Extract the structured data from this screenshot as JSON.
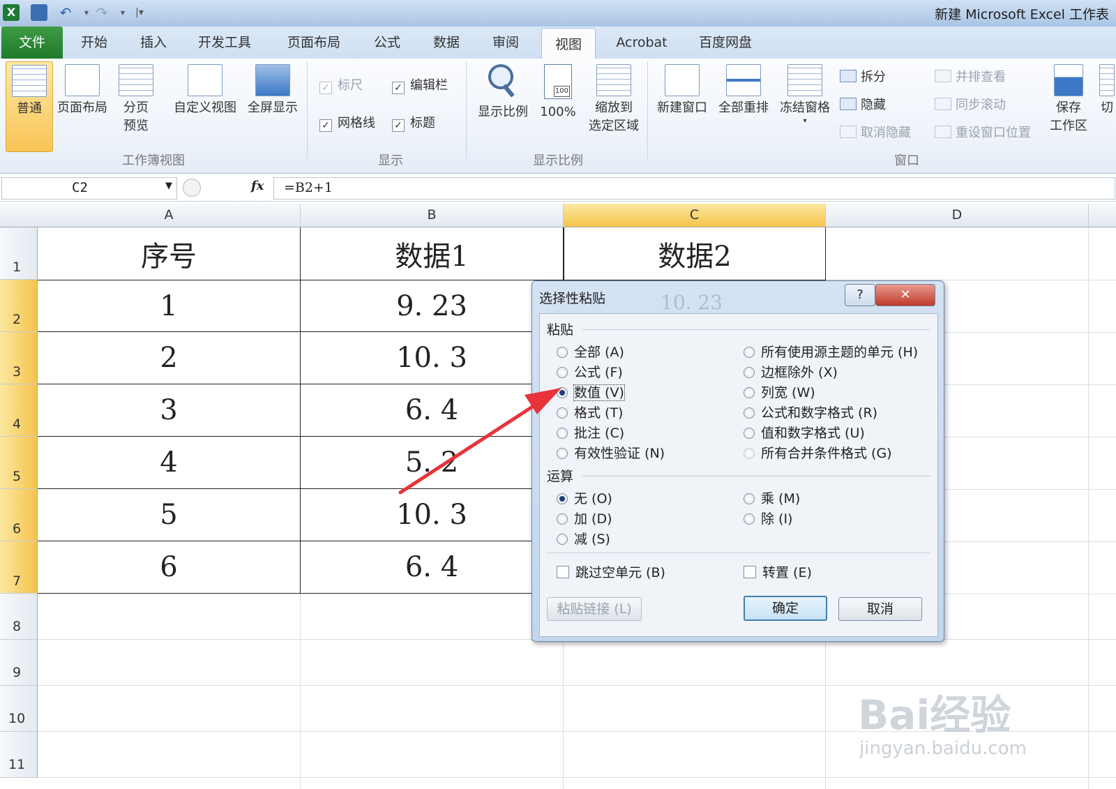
{
  "titlebar": {
    "title": "新建 Microsoft Excel 工作表"
  },
  "tabs": [
    "文件",
    "开始",
    "插入",
    "开发工具",
    "页面布局",
    "公式",
    "数据",
    "审阅",
    "视图",
    "Acrobat",
    "百度网盘"
  ],
  "ribbon": {
    "workbook_views": {
      "normal": "普通",
      "page_layout": "页面布局",
      "page_break_l1": "分页",
      "page_break_l2": "预览",
      "custom": "自定义视图",
      "fullscreen": "全屏显示",
      "group": "工作簿视图"
    },
    "show": {
      "ruler": "标尺",
      "formula_bar": "编辑栏",
      "gridlines": "网格线",
      "headings": "标题",
      "group": "显示"
    },
    "zoom": {
      "zoom": "显示比例",
      "zoom100": "100%",
      "zoom_sel_l1": "缩放到",
      "zoom_sel_l2": "选定区域",
      "group": "显示比例",
      "badge": "100"
    },
    "window": {
      "new_window": "新建窗口",
      "arrange_all": "全部重排",
      "freeze": "冻结窗格",
      "split": "拆分",
      "hide": "隐藏",
      "unhide": "取消隐藏",
      "side_by_side": "并排查看",
      "sync_scroll": "同步滚动",
      "reset_pos": "重设窗口位置",
      "save_l1": "保存",
      "save_l2": "工作区",
      "switch": "切",
      "group": "窗口"
    }
  },
  "formula_bar": {
    "name_box": "C2",
    "fx": "fx",
    "formula": "=B2+1"
  },
  "grid": {
    "columns": [
      "A",
      "B",
      "C",
      "D"
    ],
    "rows": [
      "1",
      "2",
      "3",
      "4",
      "5",
      "6",
      "7",
      "8",
      "9",
      "10",
      "11"
    ],
    "header_row": [
      "序号",
      "数据1",
      "数据2"
    ],
    "data": [
      [
        "1",
        "9. 23"
      ],
      [
        "2",
        "10. 3"
      ],
      [
        "3",
        "6. 4"
      ],
      [
        "4",
        "5. 2"
      ],
      [
        "5",
        "10. 3"
      ],
      [
        "6",
        "6. 4"
      ]
    ]
  },
  "dialog": {
    "title": "选择性粘贴",
    "help": "?",
    "close": "✕",
    "paste_label": "粘贴",
    "paste_left": [
      "全部 (A)",
      "公式 (F)",
      "数值 (V)",
      "格式 (T)",
      "批注 (C)",
      "有效性验证 (N)"
    ],
    "paste_right": [
      "所有使用源主题的单元 (H)",
      "边框除外 (X)",
      "列宽 (W)",
      "公式和数字格式 (R)",
      "值和数字格式 (U)",
      "所有合并条件格式 (G)"
    ],
    "operation_label": "运算",
    "op_left": [
      "无 (O)",
      "加 (D)",
      "减 (S)"
    ],
    "op_right": [
      "乘 (M)",
      "除 (I)"
    ],
    "skip_blanks": "跳过空单元 (B)",
    "transpose": "转置 (E)",
    "paste_link": "粘贴链接 (L)",
    "ok": "确定",
    "cancel": "取消",
    "behind_text": "10. 23"
  },
  "watermark": {
    "brand": "Bai经验",
    "url": "jingyan.baidu.com"
  },
  "colors": {
    "accent_arrow": "#e8333a",
    "selection": "#f4c34b",
    "file_tab": "#2a8a35"
  }
}
